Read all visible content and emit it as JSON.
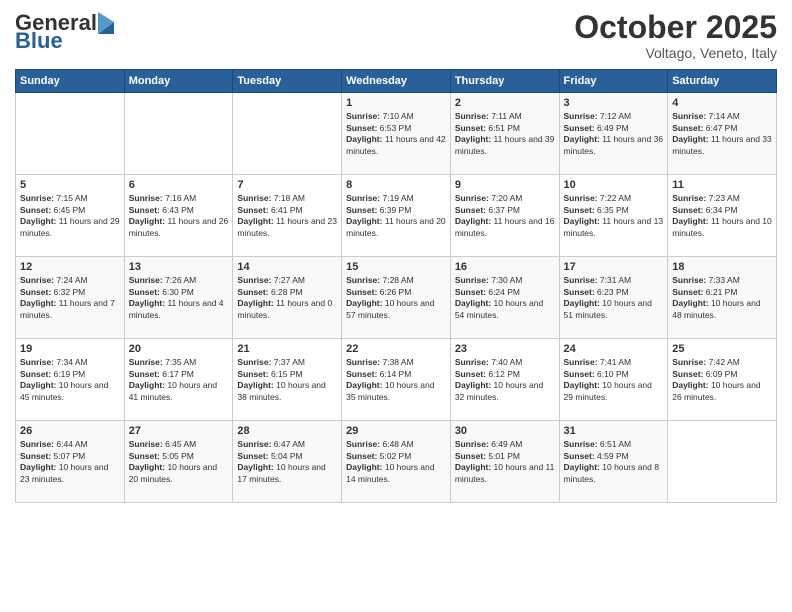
{
  "header": {
    "logo_general": "General",
    "logo_blue": "Blue",
    "month_title": "October 2025",
    "location": "Voltago, Veneto, Italy"
  },
  "days_of_week": [
    "Sunday",
    "Monday",
    "Tuesday",
    "Wednesday",
    "Thursday",
    "Friday",
    "Saturday"
  ],
  "weeks": [
    {
      "days": [
        {
          "num": "",
          "info": ""
        },
        {
          "num": "",
          "info": ""
        },
        {
          "num": "",
          "info": ""
        },
        {
          "num": "1",
          "info": "Sunrise: 7:10 AM\nSunset: 6:53 PM\nDaylight: 11 hours and 42 minutes."
        },
        {
          "num": "2",
          "info": "Sunrise: 7:11 AM\nSunset: 6:51 PM\nDaylight: 11 hours and 39 minutes."
        },
        {
          "num": "3",
          "info": "Sunrise: 7:12 AM\nSunset: 6:49 PM\nDaylight: 11 hours and 36 minutes."
        },
        {
          "num": "4",
          "info": "Sunrise: 7:14 AM\nSunset: 6:47 PM\nDaylight: 11 hours and 33 minutes."
        }
      ]
    },
    {
      "days": [
        {
          "num": "5",
          "info": "Sunrise: 7:15 AM\nSunset: 6:45 PM\nDaylight: 11 hours and 29 minutes."
        },
        {
          "num": "6",
          "info": "Sunrise: 7:16 AM\nSunset: 6:43 PM\nDaylight: 11 hours and 26 minutes."
        },
        {
          "num": "7",
          "info": "Sunrise: 7:18 AM\nSunset: 6:41 PM\nDaylight: 11 hours and 23 minutes."
        },
        {
          "num": "8",
          "info": "Sunrise: 7:19 AM\nSunset: 6:39 PM\nDaylight: 11 hours and 20 minutes."
        },
        {
          "num": "9",
          "info": "Sunrise: 7:20 AM\nSunset: 6:37 PM\nDaylight: 11 hours and 16 minutes."
        },
        {
          "num": "10",
          "info": "Sunrise: 7:22 AM\nSunset: 6:35 PM\nDaylight: 11 hours and 13 minutes."
        },
        {
          "num": "11",
          "info": "Sunrise: 7:23 AM\nSunset: 6:34 PM\nDaylight: 11 hours and 10 minutes."
        }
      ]
    },
    {
      "days": [
        {
          "num": "12",
          "info": "Sunrise: 7:24 AM\nSunset: 6:32 PM\nDaylight: 11 hours and 7 minutes."
        },
        {
          "num": "13",
          "info": "Sunrise: 7:26 AM\nSunset: 6:30 PM\nDaylight: 11 hours and 4 minutes."
        },
        {
          "num": "14",
          "info": "Sunrise: 7:27 AM\nSunset: 6:28 PM\nDaylight: 11 hours and 0 minutes."
        },
        {
          "num": "15",
          "info": "Sunrise: 7:28 AM\nSunset: 6:26 PM\nDaylight: 10 hours and 57 minutes."
        },
        {
          "num": "16",
          "info": "Sunrise: 7:30 AM\nSunset: 6:24 PM\nDaylight: 10 hours and 54 minutes."
        },
        {
          "num": "17",
          "info": "Sunrise: 7:31 AM\nSunset: 6:23 PM\nDaylight: 10 hours and 51 minutes."
        },
        {
          "num": "18",
          "info": "Sunrise: 7:33 AM\nSunset: 6:21 PM\nDaylight: 10 hours and 48 minutes."
        }
      ]
    },
    {
      "days": [
        {
          "num": "19",
          "info": "Sunrise: 7:34 AM\nSunset: 6:19 PM\nDaylight: 10 hours and 45 minutes."
        },
        {
          "num": "20",
          "info": "Sunrise: 7:35 AM\nSunset: 6:17 PM\nDaylight: 10 hours and 41 minutes."
        },
        {
          "num": "21",
          "info": "Sunrise: 7:37 AM\nSunset: 6:15 PM\nDaylight: 10 hours and 38 minutes."
        },
        {
          "num": "22",
          "info": "Sunrise: 7:38 AM\nSunset: 6:14 PM\nDaylight: 10 hours and 35 minutes."
        },
        {
          "num": "23",
          "info": "Sunrise: 7:40 AM\nSunset: 6:12 PM\nDaylight: 10 hours and 32 minutes."
        },
        {
          "num": "24",
          "info": "Sunrise: 7:41 AM\nSunset: 6:10 PM\nDaylight: 10 hours and 29 minutes."
        },
        {
          "num": "25",
          "info": "Sunrise: 7:42 AM\nSunset: 6:09 PM\nDaylight: 10 hours and 26 minutes."
        }
      ]
    },
    {
      "days": [
        {
          "num": "26",
          "info": "Sunrise: 6:44 AM\nSunset: 5:07 PM\nDaylight: 10 hours and 23 minutes."
        },
        {
          "num": "27",
          "info": "Sunrise: 6:45 AM\nSunset: 5:05 PM\nDaylight: 10 hours and 20 minutes."
        },
        {
          "num": "28",
          "info": "Sunrise: 6:47 AM\nSunset: 5:04 PM\nDaylight: 10 hours and 17 minutes."
        },
        {
          "num": "29",
          "info": "Sunrise: 6:48 AM\nSunset: 5:02 PM\nDaylight: 10 hours and 14 minutes."
        },
        {
          "num": "30",
          "info": "Sunrise: 6:49 AM\nSunset: 5:01 PM\nDaylight: 10 hours and 11 minutes."
        },
        {
          "num": "31",
          "info": "Sunrise: 6:51 AM\nSunset: 4:59 PM\nDaylight: 10 hours and 8 minutes."
        },
        {
          "num": "",
          "info": ""
        }
      ]
    }
  ]
}
